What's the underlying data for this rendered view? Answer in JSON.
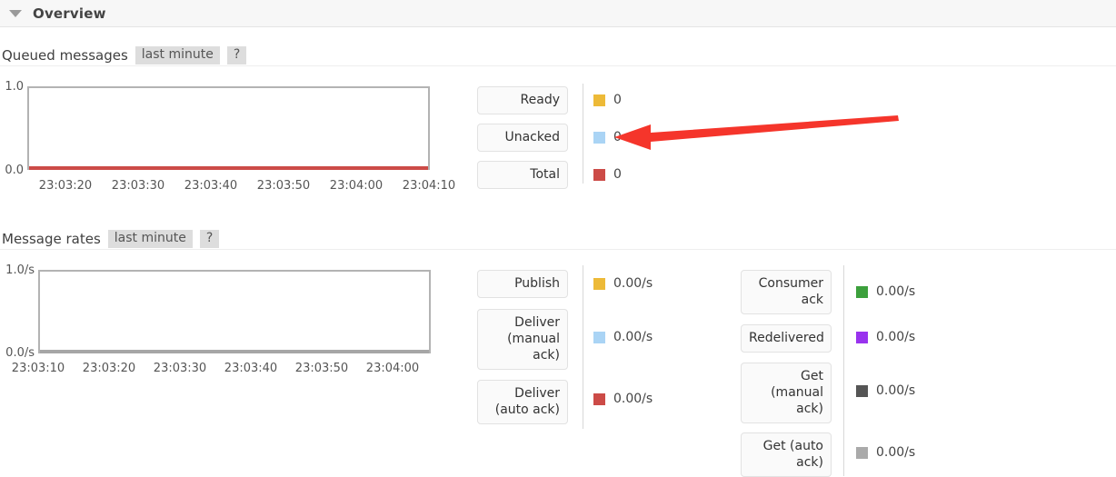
{
  "section": {
    "title": "Overview",
    "collapse_icon": "triangle-down-icon"
  },
  "queued_messages": {
    "label": "Queued messages",
    "period_badge": "last minute",
    "help_badge": "?",
    "legend": [
      {
        "label": "Ready",
        "value": "0",
        "color": "#edba38"
      },
      {
        "label": "Unacked",
        "value": "0",
        "color": "#aad4f5"
      },
      {
        "label": "Total",
        "value": "0",
        "color": "#cc4b47"
      }
    ],
    "chart": {
      "type": "line",
      "title": "Queued messages",
      "xlabel": "",
      "ylabel": "",
      "ylim": [
        0,
        1
      ],
      "yticks": [
        "0.0",
        "1.0"
      ],
      "xticks": [
        "23:03:20",
        "23:03:30",
        "23:03:40",
        "23:03:50",
        "23:04:00",
        "23:04:10"
      ],
      "grid": false,
      "legend_position": "right",
      "series": [
        {
          "name": "Ready",
          "color": "#edba38",
          "values": [
            0,
            0,
            0,
            0,
            0,
            0
          ]
        },
        {
          "name": "Unacked",
          "color": "#aad4f5",
          "values": [
            0,
            0,
            0,
            0,
            0,
            0
          ]
        },
        {
          "name": "Total",
          "color": "#cc4b47",
          "values": [
            0,
            0,
            0,
            0,
            0,
            0
          ]
        }
      ]
    }
  },
  "message_rates": {
    "label": "Message rates",
    "period_badge": "last minute",
    "help_badge": "?",
    "legend_left": [
      {
        "label": "Publish",
        "value": "0.00/s",
        "color": "#edba38"
      },
      {
        "label": "Deliver (manual ack)",
        "value": "0.00/s",
        "color": "#aad4f5"
      },
      {
        "label": "Deliver (auto ack)",
        "value": "0.00/s",
        "color": "#cc4b47"
      }
    ],
    "legend_right": [
      {
        "label": "Consumer ack",
        "value": "0.00/s",
        "color": "#3ca03c"
      },
      {
        "label": "Redelivered",
        "value": "0.00/s",
        "color": "#9933ee"
      },
      {
        "label": "Get (manual ack)",
        "value": "0.00/s",
        "color": "#555555"
      },
      {
        "label": "Get (auto ack)",
        "value": "0.00/s",
        "color": "#aaaaaa"
      }
    ],
    "chart": {
      "type": "line",
      "title": "Message rates",
      "xlabel": "",
      "ylabel": "",
      "ylim": [
        0,
        1
      ],
      "yticks": [
        "0.0/s",
        "1.0/s"
      ],
      "xticks": [
        "23:03:10",
        "23:03:20",
        "23:03:30",
        "23:03:40",
        "23:03:50",
        "23:04:00"
      ],
      "grid": false,
      "legend_position": "right",
      "series": [
        {
          "name": "Publish",
          "color": "#edba38",
          "values": [
            0,
            0,
            0,
            0,
            0,
            0
          ]
        },
        {
          "name": "Deliver (manual ack)",
          "color": "#aad4f5",
          "values": [
            0,
            0,
            0,
            0,
            0,
            0
          ]
        },
        {
          "name": "Deliver (auto ack)",
          "color": "#cc4b47",
          "values": [
            0,
            0,
            0,
            0,
            0,
            0
          ]
        },
        {
          "name": "Consumer ack",
          "color": "#3ca03c",
          "values": [
            0,
            0,
            0,
            0,
            0,
            0
          ]
        },
        {
          "name": "Redelivered",
          "color": "#9933ee",
          "values": [
            0,
            0,
            0,
            0,
            0,
            0
          ]
        },
        {
          "name": "Get (manual ack)",
          "color": "#555555",
          "values": [
            0,
            0,
            0,
            0,
            0,
            0
          ]
        },
        {
          "name": "Get (auto ack)",
          "color": "#aaaaaa",
          "values": [
            0,
            0,
            0,
            0,
            0,
            0
          ]
        }
      ]
    }
  },
  "annotation": {
    "kind": "red-arrow",
    "color": "#f5352b",
    "points_to": "Unacked"
  }
}
